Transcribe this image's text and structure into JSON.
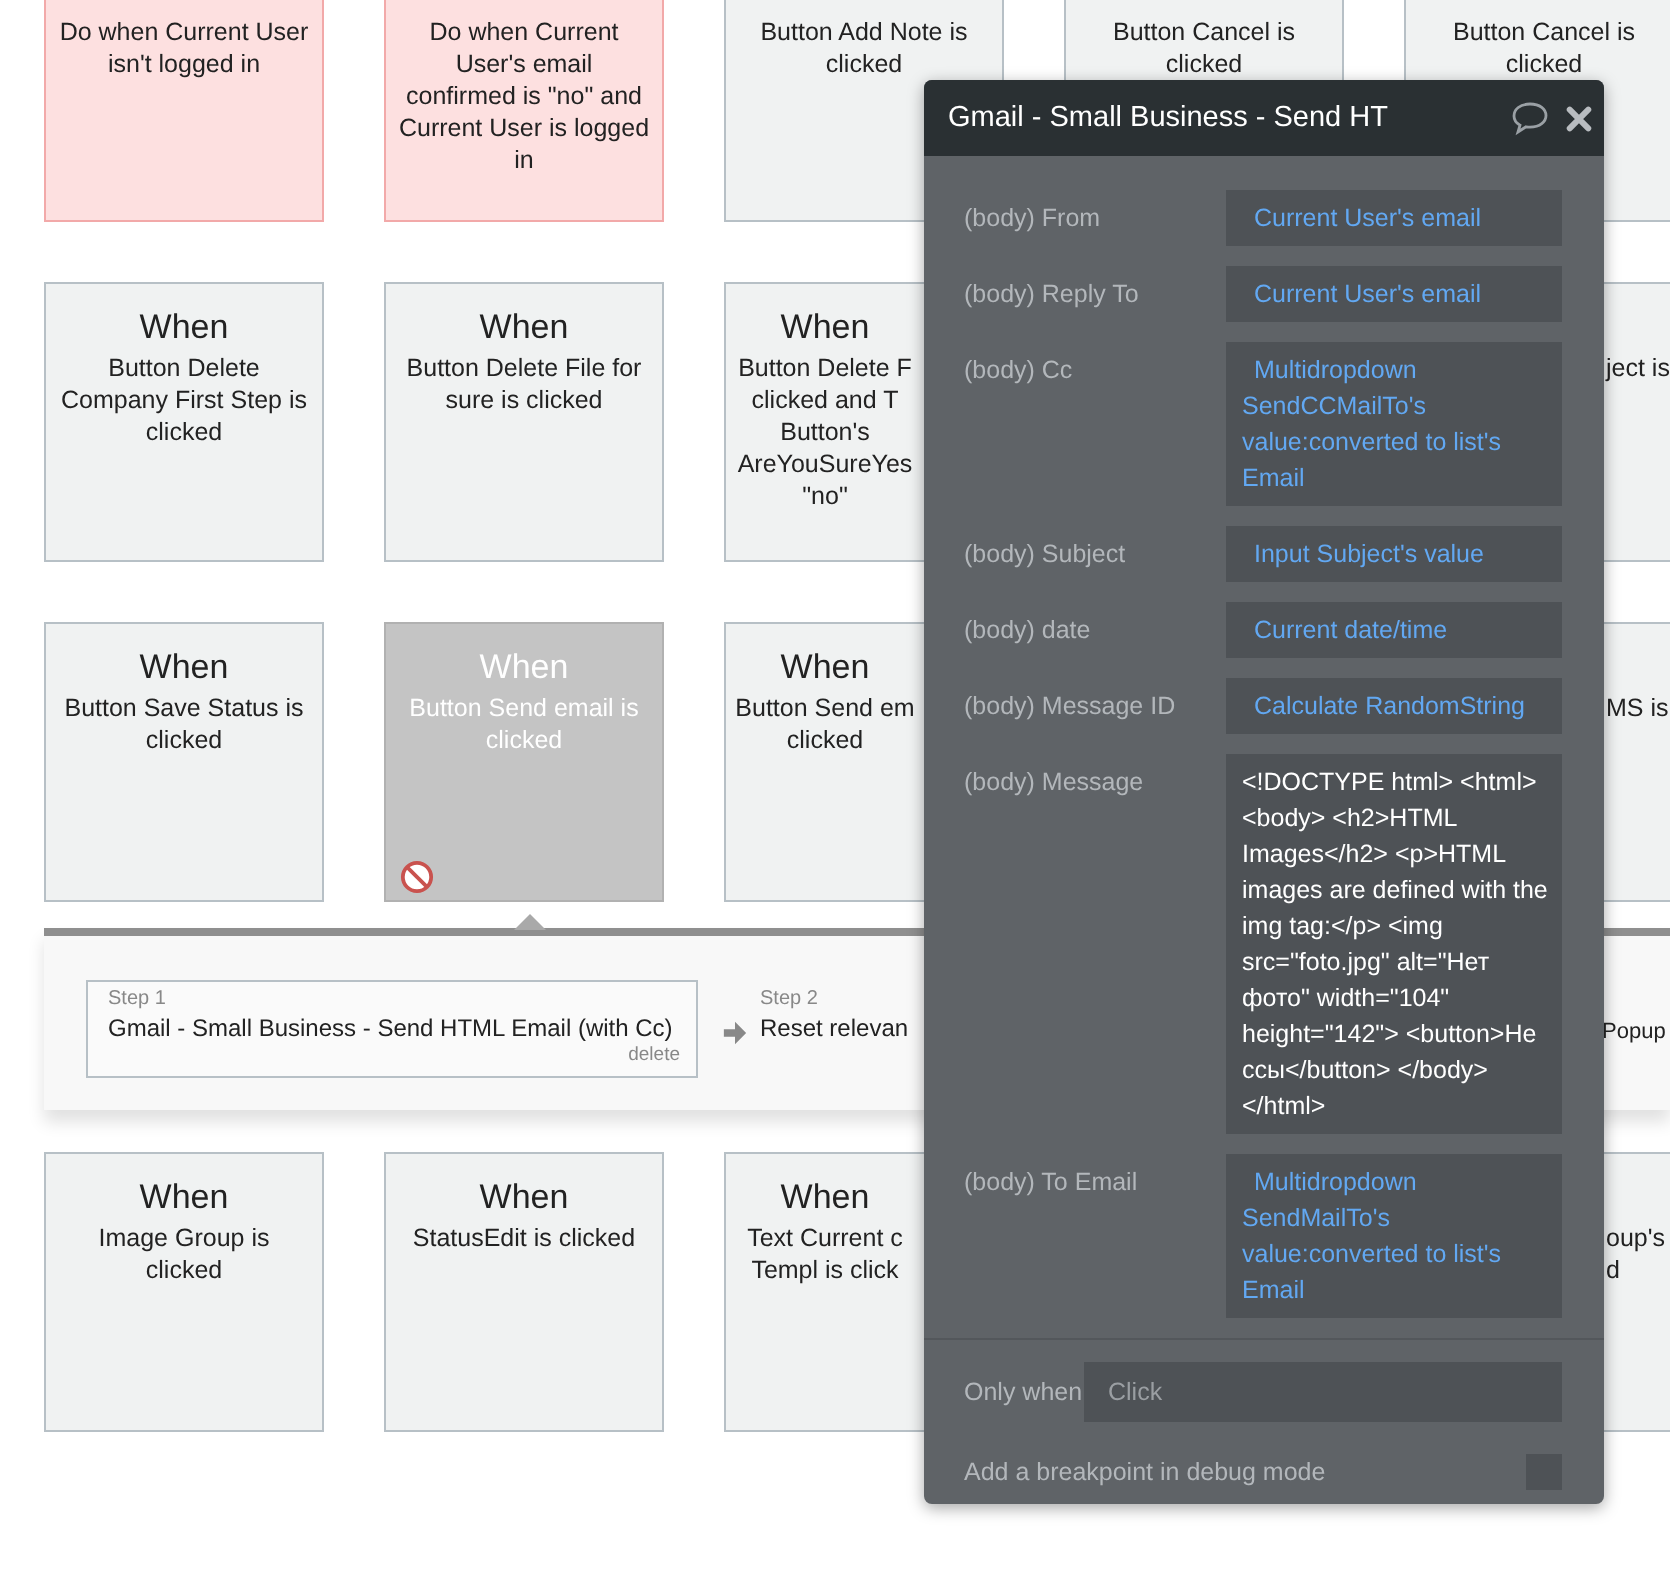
{
  "event_rows": [
    [
      {
        "kind": "condition",
        "text": "Do when Current User isn't logged in",
        "disabled": false
      },
      {
        "kind": "condition",
        "text": "Do when Current User's email confirmed is \"no\" and Current User is logged in",
        "disabled": false
      },
      {
        "kind": "event",
        "text": "Button Add Note is clicked",
        "disabled": false
      },
      {
        "kind": "event",
        "text": "Button Cancel is clicked",
        "disabled": false
      },
      {
        "kind": "event",
        "text": "Button Cancel is clicked",
        "disabled": false
      }
    ],
    [
      {
        "kind": "event",
        "title": "When",
        "text": "Button Delete Company First Step is clicked",
        "disabled": false
      },
      {
        "kind": "event",
        "title": "When",
        "text": "Button Delete File for sure is clicked",
        "disabled": false
      },
      {
        "kind": "event",
        "title": "When",
        "lines": [
          "Button Delete F",
          "clicked and T",
          "Button's",
          "AreYouSureYes",
          "\"no\""
        ],
        "disabled": false
      },
      {
        "kind": "event",
        "lines": [
          "ject is"
        ],
        "disabled": false
      }
    ],
    [
      {
        "kind": "event",
        "title": "When",
        "text": "Button Save Status is clicked",
        "disabled": false
      },
      {
        "kind": "event",
        "title": "When",
        "text": "Button Send email is clicked",
        "disabled": true
      },
      {
        "kind": "event",
        "title": "When",
        "lines": [
          "Button Send em",
          "clicked"
        ],
        "disabled": false
      },
      {
        "kind": "event",
        "lines": [
          "MS is"
        ],
        "disabled": false
      }
    ]
  ],
  "action_steps": {
    "steps": [
      {
        "label": "Step 1",
        "title": "Gmail - Small Business - Send HTML Email (with Cc)",
        "delete": "delete"
      },
      {
        "label": "Step 2",
        "title": "Reset relevan"
      }
    ],
    "hidden_step_text": "Popup"
  },
  "more_event_rows": [
    [
      {
        "kind": "event",
        "title": "When",
        "text": "Image Group is clicked",
        "disabled": false
      },
      {
        "kind": "event",
        "title": "When",
        "text": "StatusEdit is clicked",
        "disabled": false
      },
      {
        "kind": "event",
        "title": "When",
        "lines": [
          "Text Current c",
          "Templ is click"
        ],
        "disabled": false
      },
      {
        "kind": "event",
        "lines": [
          "oup's",
          "d"
        ],
        "disabled": false
      }
    ]
  ],
  "editor": {
    "title": "Gmail - Small Business - Send HT",
    "fields": [
      {
        "label": "(body) From",
        "kind": "expression",
        "value": "Current User's email"
      },
      {
        "label": "(body) Reply To",
        "kind": "expression",
        "value": "Current User's email"
      },
      {
        "label": "(body) Cc",
        "kind": "expression",
        "value": "Multidropdown SendCCMailTo's value:converted to list's Email"
      },
      {
        "label": "(body) Subject",
        "kind": "expression",
        "value": "Input Subject's value"
      },
      {
        "label": "(body) date",
        "kind": "expression",
        "value": "Current date/time"
      },
      {
        "label": "(body) Message ID",
        "kind": "expression",
        "value": "Calculate RandomString"
      },
      {
        "label": "(body) Message",
        "kind": "text",
        "value": "<!DOCTYPE html> <html> <body>  <h2>HTML Images</h2> <p>HTML images are defined with the img tag:</p> <img src=\"foto.jpg\" alt=\"Нет фото\" width=\"104\" height=\"142\"> <button>Не ссы</button> </body> </html>"
      },
      {
        "label": "(body) To Email",
        "kind": "expression",
        "value": "Multidropdown SendMailTo's value:converted to list's Email"
      }
    ],
    "only_when": {
      "label": "Only when",
      "placeholder": "Click"
    },
    "breakpoint": {
      "label": "Add a breakpoint in debug mode",
      "checked": false
    }
  }
}
